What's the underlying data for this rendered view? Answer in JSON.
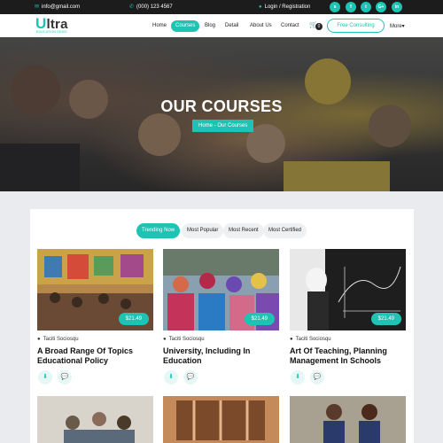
{
  "topbar": {
    "email": "info@gmail.com",
    "phone": "(000) 123 4567",
    "login": "Login / Registration",
    "social": [
      "s",
      "f",
      "t",
      "G+",
      "in"
    ]
  },
  "nav": {
    "logo_brand_rest": "ltra",
    "logo_brand_first": "U",
    "logo_tagline": "EDUCATION DEMO",
    "items": [
      "Home",
      "Courses",
      "Blog",
      "Detail",
      "About Us",
      "Contact"
    ],
    "cart_count": "0",
    "cta": "Free Consulting",
    "more": "More▾"
  },
  "hero": {
    "title": "OUR COURSES",
    "breadcrumb": "Home - Our Courses"
  },
  "tabs": [
    "Trending Now",
    "Most Popular",
    "Most Recent",
    "Most Certified"
  ],
  "courses": [
    {
      "price": "$21.49",
      "author": "Taciti Sociosqu",
      "title": "A Broad Range Of Topics Educational Policy"
    },
    {
      "price": "$21.49",
      "author": "Taciti Sociosqu",
      "title": "University, Including In Education"
    },
    {
      "price": "$21.49",
      "author": "Taciti Sociosqu",
      "title": "Art Of Teaching, Planning Management In Schools"
    }
  ],
  "colors": {
    "accent": "#1ec3b4",
    "topbar": "#1c1c1c"
  }
}
